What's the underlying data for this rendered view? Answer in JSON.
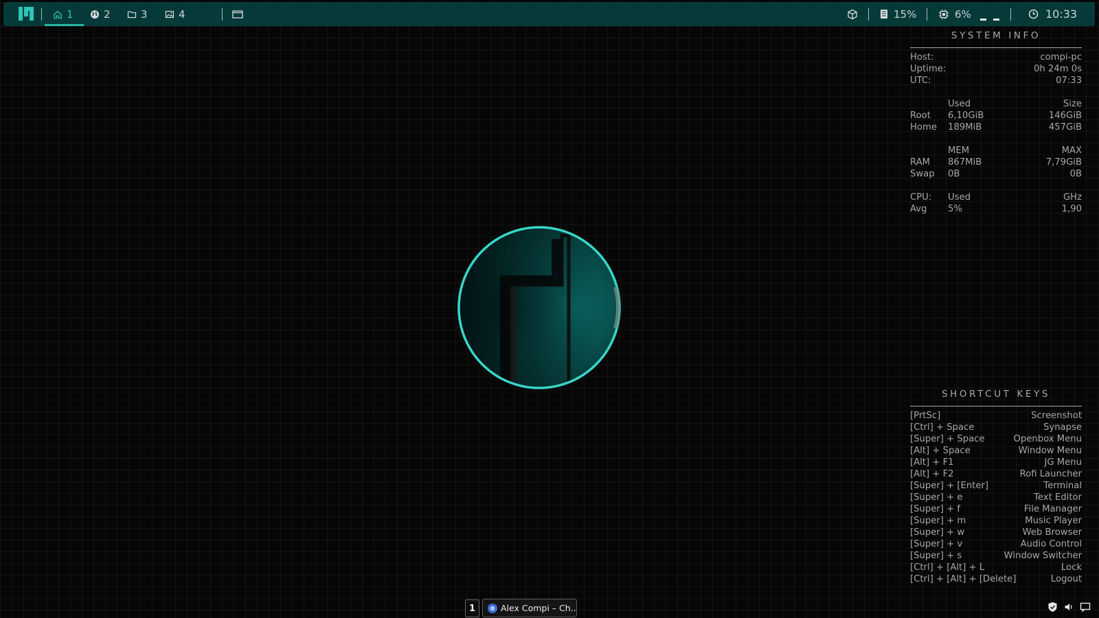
{
  "topbar": {
    "workspaces": [
      {
        "icon": "home-icon",
        "label": "1",
        "active": true
      },
      {
        "icon": "globe-icon",
        "label": "2",
        "active": false
      },
      {
        "icon": "folder-icon",
        "label": "3",
        "active": false
      },
      {
        "icon": "image-icon",
        "label": "4",
        "active": false
      }
    ],
    "window_icon": "window-icon",
    "tray": {
      "package_icon": "package-icon",
      "memory_icon": "memory-icon",
      "memory_percent": "15%",
      "cpu_icon": "cpu-icon",
      "cpu_percent": "6%",
      "clock_icon": "clock-icon",
      "time": "10:33"
    },
    "accent": "#2ec4b6",
    "bar_color": "#063a39"
  },
  "system_info": {
    "title": "SYSTEM INFO",
    "host_label": "Host:",
    "host_value": "compi-pc",
    "uptime_label": "Uptime:",
    "uptime_value": "0h 24m 0s",
    "utc_label": "UTC:",
    "utc_value": "07:33",
    "disk_header_used": "Used",
    "disk_header_size": "Size",
    "root_label": "Root",
    "root_used": "6,10GiB",
    "root_size": "146GiB",
    "home_label": "Home",
    "home_used": "189MiB",
    "home_size": "457GiB",
    "mem_header_mem": "MEM",
    "mem_header_max": "MAX",
    "ram_label": "RAM",
    "ram_used": "867MiB",
    "ram_max": "7,79GiB",
    "swap_label": "Swap",
    "swap_used": "0B",
    "swap_max": "0B",
    "cpu_label": "CPU:",
    "cpu_header_used": "Used",
    "cpu_header_ghz": "GHz",
    "avg_label": "Avg",
    "avg_used": "5%",
    "avg_ghz": "1,90"
  },
  "shortcuts": {
    "title": "SHORTCUT KEYS",
    "items": [
      {
        "keys": "[PrtSc]",
        "action": "Screenshot"
      },
      {
        "keys": "[Ctrl] + Space",
        "action": "Synapse"
      },
      {
        "keys": "[Super] + Space",
        "action": "Openbox Menu"
      },
      {
        "keys": "[Alt] + Space",
        "action": "Window Menu"
      },
      {
        "keys": "[Alt] + F1",
        "action": "JG Menu"
      },
      {
        "keys": "[Alt] + F2",
        "action": "Rofi Launcher"
      },
      {
        "keys": "[Super] + [Enter]",
        "action": "Terminal"
      },
      {
        "keys": "[Super] + e",
        "action": "Text Editor"
      },
      {
        "keys": "[Super] + f",
        "action": "File Manager"
      },
      {
        "keys": "[Super] + m",
        "action": "Music Player"
      },
      {
        "keys": "[Super] + w",
        "action": "Web Browser"
      },
      {
        "keys": "[Super] + v",
        "action": "Audio Control"
      },
      {
        "keys": "[Super] + s",
        "action": "Window Switcher"
      },
      {
        "keys": "[Ctrl] + [Alt] + L",
        "action": "Lock"
      },
      {
        "keys": "[Ctrl] + [Alt] + [Delete]",
        "action": "Logout"
      }
    ]
  },
  "taskbar": {
    "desktop_number": "1",
    "app_icon": "chrome-icon",
    "app_label": "Alex Compi – Ch...",
    "tray_icons": [
      "shield-icon",
      "volume-icon",
      "notification-icon"
    ]
  }
}
